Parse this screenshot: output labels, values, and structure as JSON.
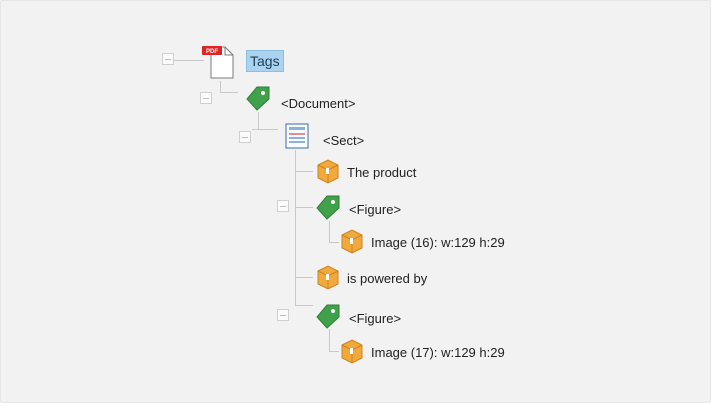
{
  "tree": {
    "root": {
      "label": "Tags",
      "icon": "pdf-file-icon",
      "badge": "PDF"
    },
    "document": {
      "label": "<Document>",
      "icon": "tag-icon"
    },
    "sect": {
      "label": "<Sect>",
      "icon": "section-icon"
    },
    "content1": {
      "label": "The product",
      "icon": "content-box-icon"
    },
    "figure1": {
      "label": "<Figure>",
      "icon": "tag-icon"
    },
    "image1": {
      "label": "Image (16): w:129 h:29",
      "icon": "content-box-icon"
    },
    "content2": {
      "label": "is powered by",
      "icon": "content-box-icon"
    },
    "figure2": {
      "label": "<Figure>",
      "icon": "tag-icon"
    },
    "image2": {
      "label": "Image (17): w:129 h:29",
      "icon": "content-box-icon"
    }
  },
  "colors": {
    "tag": "#3fa14a",
    "box": "#f2a93b",
    "selection": "#a9d3ef",
    "connector": "#c8c8c8",
    "pdf_badge": "#e02424"
  }
}
